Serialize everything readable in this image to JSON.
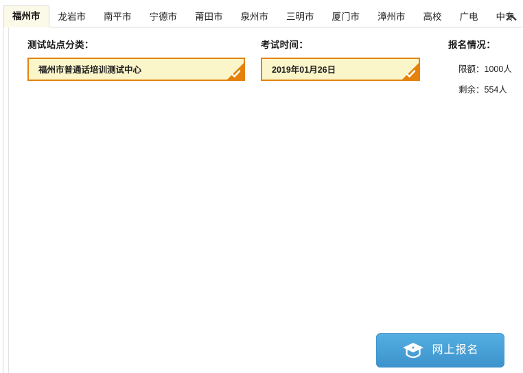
{
  "tabs": {
    "items": [
      {
        "label": "福州市",
        "active": true
      },
      {
        "label": "龙岩市",
        "active": false
      },
      {
        "label": "南平市",
        "active": false
      },
      {
        "label": "宁德市",
        "active": false
      },
      {
        "label": "莆田市",
        "active": false
      },
      {
        "label": "泉州市",
        "active": false
      },
      {
        "label": "三明市",
        "active": false
      },
      {
        "label": "厦门市",
        "active": false
      },
      {
        "label": "漳州市",
        "active": false
      },
      {
        "label": "高校",
        "active": false
      },
      {
        "label": "广电",
        "active": false
      },
      {
        "label": "中专",
        "active": false
      }
    ],
    "collapse_icon": "chevron-up-icon"
  },
  "form": {
    "site": {
      "label": "测试站点分类：",
      "selected_value": "福州市普通话培训测试中心",
      "selected_marker_icon": "check-icon"
    },
    "time": {
      "label": "考试时间：",
      "selected_value": "2019年01月26日",
      "selected_marker_icon": "check-icon"
    },
    "quota": {
      "title": "报名情况：",
      "limit_text": "限额：1000人",
      "remaining_text": "剩余：554人"
    }
  },
  "action": {
    "register_label": "网上报名",
    "register_icon": "graduation-cap-icon"
  },
  "colors": {
    "accent_orange": "#e4820b",
    "option_fill": "#fbf5ca",
    "active_tab_fill": "#fbf9e7",
    "button_blue_top": "#55aee0",
    "button_blue_bottom": "#3d93cd"
  }
}
